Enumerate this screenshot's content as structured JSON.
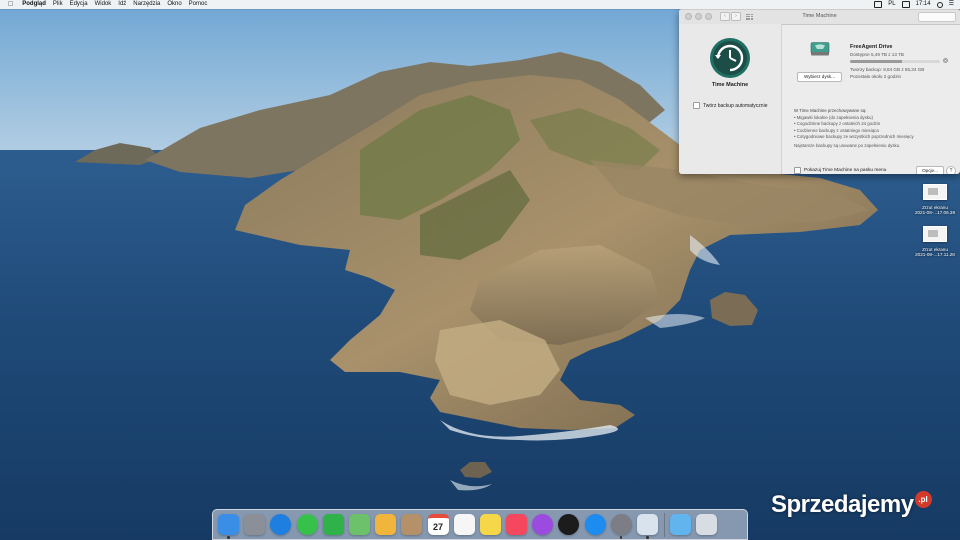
{
  "menubar": {
    "apple_icon": "apple-logo-icon",
    "items": [
      "Podgląd",
      "Plik",
      "Edycja",
      "Widok",
      "Idź",
      "Narzędzia",
      "Okno",
      "Pomoc"
    ],
    "input_source": "PL",
    "clock": "17:14"
  },
  "time_machine": {
    "window_title": "Time Machine",
    "app_label": "Time Machine",
    "auto_backup_label": "Twórz backup automatycznie",
    "auto_backup_checked": false,
    "choose_disk_label": "Wybierz dysk...",
    "drive": {
      "name": "FreeAgent Drive",
      "available": "Dostępne 5,49 TB z 13 TB",
      "used_fraction": 0.58,
      "oldest_backup": "Tworzy backup: 9,84 GB z 65,34 GB",
      "next_backup": "Pozostało około 2 godzin"
    },
    "description_head": "W Time Machine przechowywane są:",
    "description_items": [
      "Migawki lokalne (do zapełnienia dysku)",
      "Cogodzinne backupy z ostatnich 24 godzin",
      "Codzienne backupy z ostatniego miesiąca",
      "Cotygodniowe backupy ze wszystkich poprzednich miesięcy"
    ],
    "description_note": "Najstarsze backupy są usuwane po zapełnieniu dysku.",
    "show_in_menubar_label": "Pokazuj Time Machine na pasku menu",
    "show_in_menubar_checked": false,
    "options_label": "Opcje...",
    "help_label": "?"
  },
  "desktop_icons": [
    {
      "line1": "Zrzut ekranu",
      "line2": "2021-08-...17.06.39"
    },
    {
      "line1": "Zrzut ekranu",
      "line2": "2021-08-...17.11.28"
    }
  ],
  "dock": {
    "items": [
      {
        "name": "finder-icon",
        "color": "#3a8ee6",
        "running": true
      },
      {
        "name": "launchpad-icon",
        "color": "#8a8f98",
        "running": false
      },
      {
        "name": "safari-icon",
        "color": "#1f7fe0",
        "running": false
      },
      {
        "name": "messages-icon",
        "color": "#36c24a",
        "running": false
      },
      {
        "name": "facetime-icon",
        "color": "#2fb24a",
        "running": false
      },
      {
        "name": "maps-icon",
        "color": "#6cc16a",
        "running": false
      },
      {
        "name": "photos-icon",
        "color": "#f2b53b",
        "running": false
      },
      {
        "name": "contacts-icon",
        "color": "#b5916a",
        "running": false
      },
      {
        "name": "calendar-icon",
        "color": "#ffffff",
        "running": false
      },
      {
        "name": "reminders-icon",
        "color": "#f6f6f6",
        "running": false
      },
      {
        "name": "notes-icon",
        "color": "#f6d74a",
        "running": false
      },
      {
        "name": "music-icon",
        "color": "#f5485e",
        "running": false
      },
      {
        "name": "podcasts-icon",
        "color": "#9b4be0",
        "running": false
      },
      {
        "name": "apple-tv-icon",
        "color": "#1c1c1c",
        "running": false
      },
      {
        "name": "app-store-icon",
        "color": "#1d8cf0",
        "running": false
      },
      {
        "name": "system-preferences-icon",
        "color": "#7d7d85",
        "running": true
      },
      {
        "name": "preview-icon",
        "color": "#d9e3ee",
        "running": true
      }
    ],
    "right_items": [
      {
        "name": "downloads-folder-icon",
        "color": "#62b4ee",
        "running": false
      },
      {
        "name": "trash-icon",
        "color": "#d8dde3",
        "running": false
      }
    ],
    "calendar_day": "27"
  },
  "watermark": {
    "brand": "Sprzedajemy",
    "badge": ".pl"
  }
}
